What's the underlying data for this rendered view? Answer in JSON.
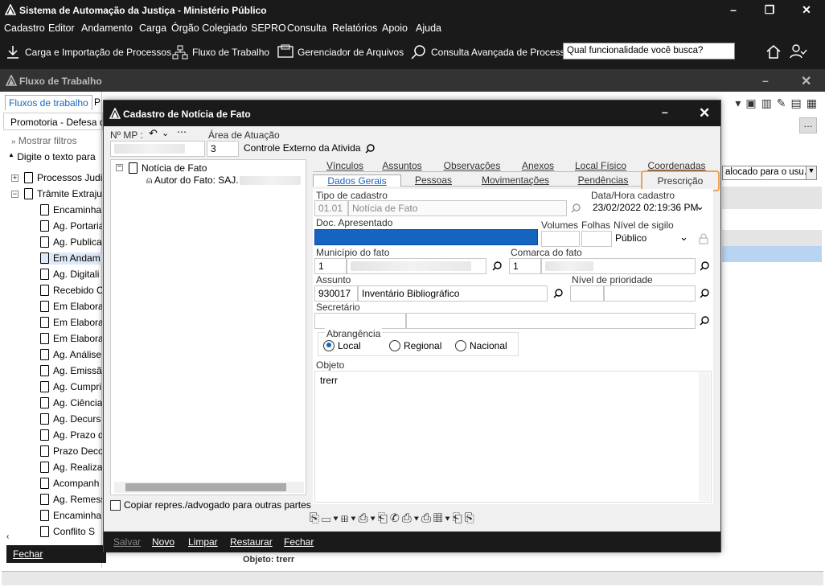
{
  "app": {
    "title": "Sistema de Automação da Justiça - Ministério Público"
  },
  "menu": [
    "Cadastro",
    "Editor",
    "Andamento",
    "Carga",
    "Órgão Colegiado",
    "SEPRO",
    "Consulta",
    "Relatórios",
    "Apoio",
    "Ajuda"
  ],
  "toolbar": {
    "carga": "Carga e Importação de Processos",
    "fluxo": "Fluxo de Trabalho",
    "gerenciador": "Gerenciador de Arquivos",
    "consulta": "Consulta Avançada de Processo:",
    "search_placeholder": "Qual funcionalidade você busca?"
  },
  "flow": {
    "title": "Fluxo de Trabalho",
    "tab_fluxos": "Fluxos de trabalho",
    "tab_p": "P",
    "promotoria": "Promotoria - Defesa de",
    "mostrar_filtros": "Mostrar filtros",
    "digite": "Digite o texto para",
    "tree": [
      "Processos Judi",
      "Trâmite Extraju",
      "Encaminha",
      "Ag. Portaria",
      "Ag. Publica",
      "Em Andam",
      "Ag. Digitali",
      "Recebido C",
      "Em Elabora",
      "Em Elabora",
      "Em Elabora",
      "Ag. Análise",
      "Ag. Emissão",
      "Ag. Cumpri",
      "Ag. Ciência",
      "Ag. Decurs",
      "Ag. Prazo d",
      "Prazo Deco",
      "Ag. Realiza",
      "Acompanh",
      "Ag. Remess",
      "Encaminha",
      "Conflito S"
    ],
    "fechar": "Fechar",
    "right_combo": "alocado para o usu...",
    "objeto": "Objeto: trerr"
  },
  "dialog": {
    "title": "Cadastro de Notícia de Fato",
    "nmp_label": "Nº MP :",
    "area_label": "Área de Atuação",
    "area_code": "3",
    "area_value": "Controle Externo da Atividad",
    "tree_root": "Notícia de Fato",
    "tree_child": "Autor do Fato: SAJ.",
    "copiar": "Copiar repres./advogado para outras partes",
    "tabs_row1": [
      "Vínculos",
      "Assuntos",
      "Observações",
      "Anexos",
      "Local Físico",
      "Coordenadas"
    ],
    "tabs_row2": [
      "Dados Gerais",
      "Pessoas",
      "Movimentações",
      "Pendências",
      "Prescrição"
    ],
    "tipo_label": "Tipo de cadastro",
    "tipo_code": "01.01",
    "tipo_value": "Notícia de Fato",
    "data_label": "Data/Hora cadastro",
    "data_value": "23/02/2022 02:19:36 PM",
    "doc_label": "Doc. Apresentado",
    "volumes_label": "Volumes",
    "folhas_label": "Folhas",
    "sigilo_label": "Nível de sigilo",
    "sigilo_value": "Público",
    "municipio_label": "Município do fato",
    "municipio_code": "1",
    "comarca_label": "Comarca do fato",
    "comarca_code": "1",
    "assunto_label": "Assunto",
    "assunto_code": "930017",
    "assunto_value": "Inventário Bibliográfico",
    "prioridade_label": "Nível de prioridade",
    "secretario_label": "Secretário",
    "abrangencia_label": "Abrangência",
    "radio_local": "Local",
    "radio_regional": "Regional",
    "radio_nacional": "Nacional",
    "objeto_label": "Objeto",
    "objeto_value": "trerr",
    "footer": {
      "salvar": "Salvar",
      "novo": "Novo",
      "limpar": "Limpar",
      "restaurar": "Restaurar",
      "fechar": "Fechar"
    }
  },
  "colors": {
    "dark": "#1a1a1a",
    "accent": "#1565c0",
    "highlight": "#f0a050"
  }
}
